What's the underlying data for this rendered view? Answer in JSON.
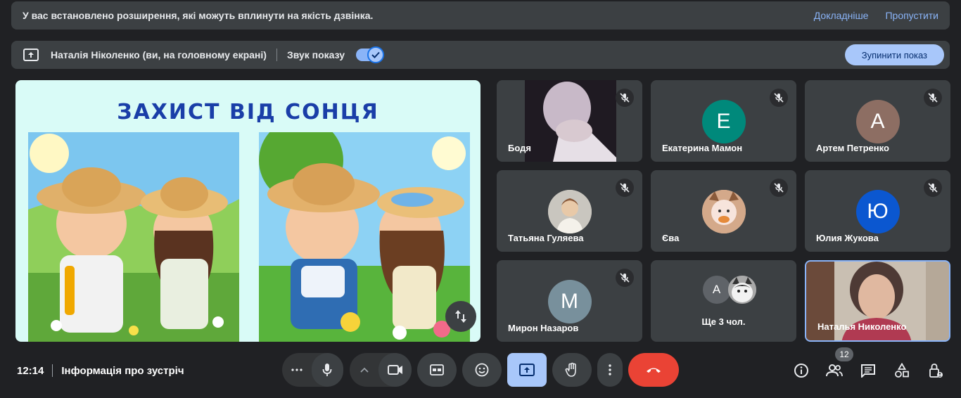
{
  "banner": {
    "message": "У вас встановлено розширення, які можуть вплинути на якість дзвінка.",
    "details_label": "Докладніше",
    "skip_label": "Пропустити"
  },
  "presenting": {
    "presenter": "Наталія Ніколенко (ви, на головному екрані)",
    "sound_label": "Звук показу",
    "sound_on": true,
    "stop_label": "Зупинити показ"
  },
  "slide": {
    "title": "ЗАХИСТ ВІД СОНЦЯ"
  },
  "participants": [
    {
      "name": "Бодя",
      "type": "video",
      "muted": true
    },
    {
      "name": "Екатерина Мамон",
      "type": "avatar",
      "initial": "Е",
      "color": "#00897b",
      "muted": true
    },
    {
      "name": "Артем Петренко",
      "type": "avatar",
      "initial": "А",
      "color": "#8d6e63",
      "muted": true
    },
    {
      "name": "Татьяна Гуляева",
      "type": "photo",
      "muted": true
    },
    {
      "name": "Єва",
      "type": "photo",
      "muted": true
    },
    {
      "name": "Юлия Жукова",
      "type": "avatar",
      "initial": "Ю",
      "color": "#0b57d0",
      "muted": true
    },
    {
      "name": "Мирон Назаров",
      "type": "avatar",
      "initial": "М",
      "color": "#78909c",
      "muted": true
    },
    {
      "name": "Ще 3 чол.",
      "type": "more",
      "initial": "А"
    },
    {
      "name": "Наталья Николенко",
      "type": "self-video",
      "muted": false
    }
  ],
  "footer": {
    "time": "12:14",
    "meeting_info": "Інформація про зустріч",
    "people_count": "12"
  },
  "colors": {
    "background": "#202124",
    "surface": "#3c4043",
    "accent": "#a8c7fa",
    "end_call": "#ea4335",
    "link": "#8ab4f8"
  }
}
